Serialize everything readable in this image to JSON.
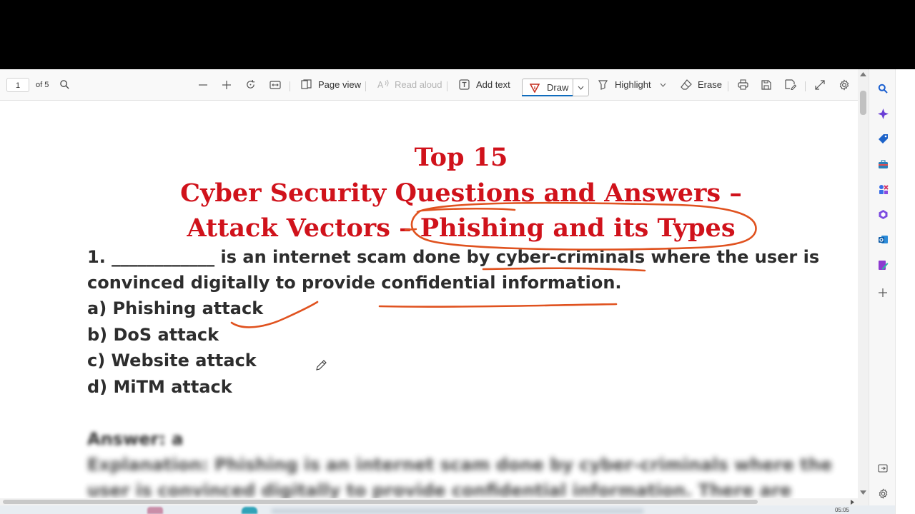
{
  "toolbar": {
    "page_current": "1",
    "page_of": "of 5",
    "page_view": "Page view",
    "read_aloud": "Read aloud",
    "add_text": "Add text",
    "draw": "Draw",
    "highlight": "Highlight",
    "erase": "Erase"
  },
  "document": {
    "title_lines": [
      "Top 15",
      "Cyber Security Questions and Answers –",
      "Attack Vectors – Phishing and its Types"
    ],
    "question_line1": "1. ____________ is an internet scam done by cyber-criminals where the user is",
    "question_line2": "convinced digitally to provide confidential information.",
    "options": [
      "a) Phishing attack",
      "b) DoS attack",
      "c) Website attack",
      "d) MiTM attack"
    ],
    "answer": "Answer: a",
    "explanation_line1": "Explanation: Phishing is an internet scam done by cyber-criminals where the",
    "explanation_line2": "user is convinced digitally to provide confidential information. There are"
  },
  "taskbar": {
    "clock": "05:05"
  },
  "colors": {
    "title_red": "#d0121b",
    "ink_orange": "#e0521f",
    "accent_blue": "#0f6cbd"
  },
  "icons": {
    "sidebar": [
      "search-icon",
      "copilot-icon",
      "tag-icon",
      "briefcase-icon",
      "games-icon",
      "office-icon",
      "outlook-icon",
      "designer-icon",
      "add-icon"
    ],
    "sidebar_bottom": [
      "panel-toggle-icon",
      "settings-icon"
    ]
  }
}
